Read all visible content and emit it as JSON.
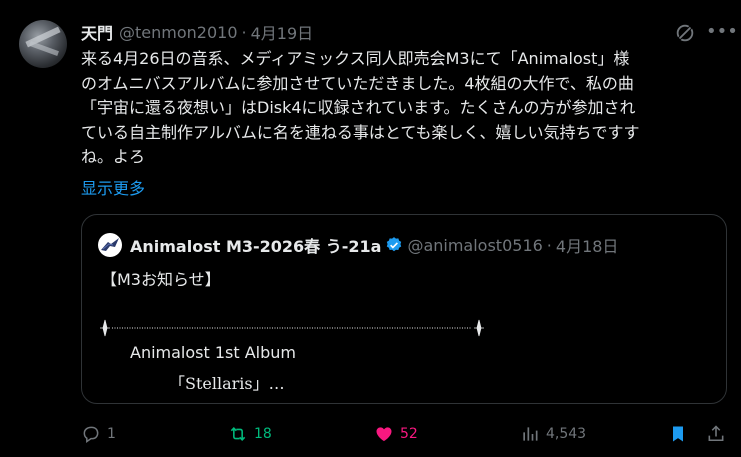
{
  "author": {
    "name": "天門",
    "handle": "@tenmon2010",
    "date": "4月19日"
  },
  "post": {
    "text": "来る4月26日の音系、メディアミックス同人即売会M3にて「Animalost」様\nのオムニバスアルバムに参加させていただきました。4枚組の大作で、私の曲\n「宇宙に還る夜想い」はDisk4に収録されています。たくさんの方が参加され\nている自主制作アルバムに名を連ねる事はとても楽しく、嬉しい気持ちですす\nね。よろ",
    "show_more": "显示更多"
  },
  "quote": {
    "name": "Animalost M3-2026春 う-21a",
    "handle": "@animalost0516",
    "date": "4月18日",
    "title": "【M3お知らせ】",
    "album_line1": "Animalost 1st Album",
    "album_line2": "「Stellaris」…"
  },
  "actions": {
    "replies": "1",
    "reposts": "18",
    "likes": "52",
    "views": "4,543"
  },
  "colors": {
    "accent": "#1d9bf0",
    "repost": "#00ba7c",
    "like": "#f91880",
    "muted": "#71767b"
  }
}
